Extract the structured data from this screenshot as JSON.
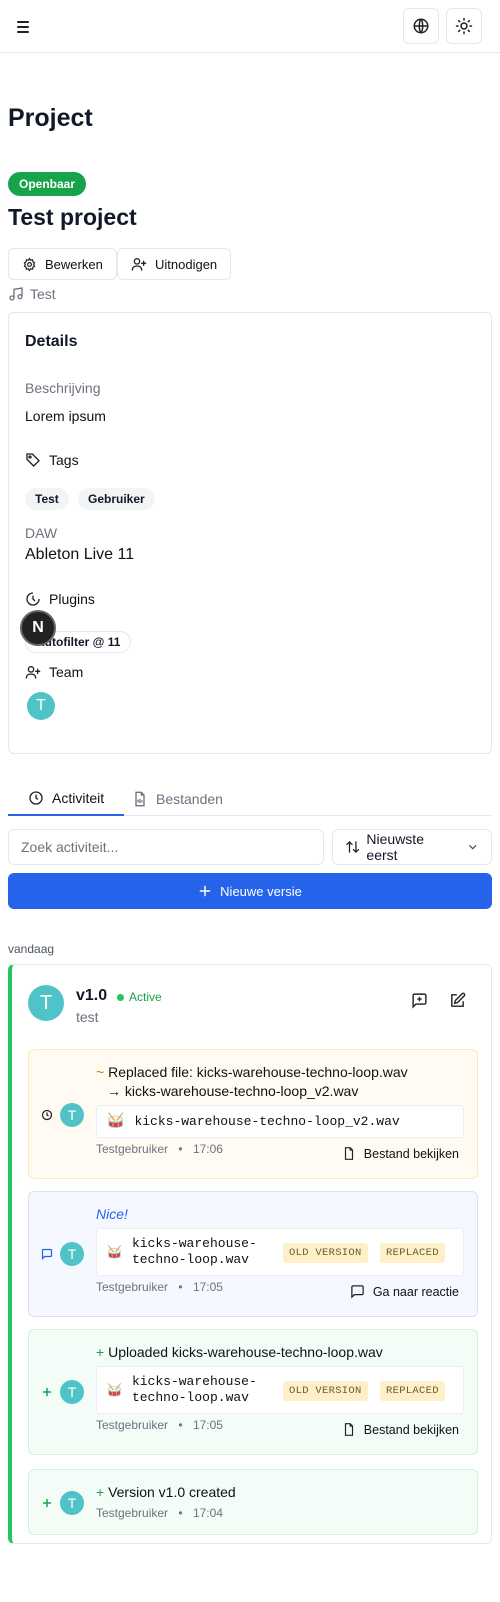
{
  "header": {
    "menu_icon": "hamburger-icon",
    "language_icon": "globe-icon",
    "theme_icon": "sun-icon"
  },
  "page": {
    "title": "Project",
    "visibility_badge": "Openbaar",
    "project_name": "Test project",
    "edit_label": "Bewerken",
    "invite_label": "Uitnodigen",
    "genre": "Test"
  },
  "details": {
    "heading": "Details",
    "description_label": "Beschrijving",
    "description": "Lorem ipsum",
    "tags_label": "Tags",
    "tags": [
      "Test",
      "Gebruiker"
    ],
    "daw_label": "DAW",
    "daw": "Ableton Live 11",
    "plugins_label": "Plugins",
    "plugins": [
      "Autofilter @ 11"
    ],
    "team_label": "Team",
    "team": [
      {
        "initial": "T"
      }
    ]
  },
  "overlay": {
    "badge": "N"
  },
  "tabs": [
    {
      "label": "Activiteit",
      "active": true
    },
    {
      "label": "Bestanden",
      "active": false
    }
  ],
  "activity": {
    "search_placeholder": "Zoek activiteit...",
    "sort_label": "Nieuwste eerst",
    "new_version_label": "Nieuwe versie",
    "day_label": "vandaag"
  },
  "version": {
    "name": "v1.0",
    "status": "Active",
    "description": "test",
    "avatar_initial": "T",
    "items": [
      {
        "type": "replace",
        "symbol": "~",
        "line1": "Replaced file: kicks-warehouse-techno-loop.wav",
        "line2": "→ kicks-warehouse-techno-loop_v2.wav",
        "file": "kicks-warehouse-techno-loop_v2.wav",
        "user": "Testgebruiker",
        "time": "17:06",
        "action": "Bestand bekijken"
      },
      {
        "type": "comment",
        "comment": "Nice!",
        "file_line1": "kicks-warehouse-",
        "file_line2": "techno-loop.wav",
        "badge_old": "OLD VERSION",
        "badge_replaced": "REPLACED",
        "user": "Testgebruiker",
        "time": "17:05",
        "action": "Ga naar reactie"
      },
      {
        "type": "upload",
        "symbol": "+",
        "title": "Uploaded kicks-warehouse-techno-loop.wav",
        "file_line1": "kicks-warehouse-",
        "file_line2": "techno-loop.wav",
        "badge_old": "OLD VERSION",
        "badge_replaced": "REPLACED",
        "user": "Testgebruiker",
        "time": "17:05",
        "action": "Bestand bekijken"
      },
      {
        "type": "created",
        "symbol": "+",
        "title": "Version v1.0 created",
        "user": "Testgebruiker",
        "time": "17:04"
      }
    ]
  },
  "meta_separator": "•",
  "colors": {
    "primary": "#2563eb",
    "success": "#16a34a",
    "version_accent": "#22c55e",
    "avatar": "#4fc3c8",
    "badge_bg": "#fdf0c8",
    "replace_symbol": "#d97706",
    "comment_text": "#2563eb"
  }
}
